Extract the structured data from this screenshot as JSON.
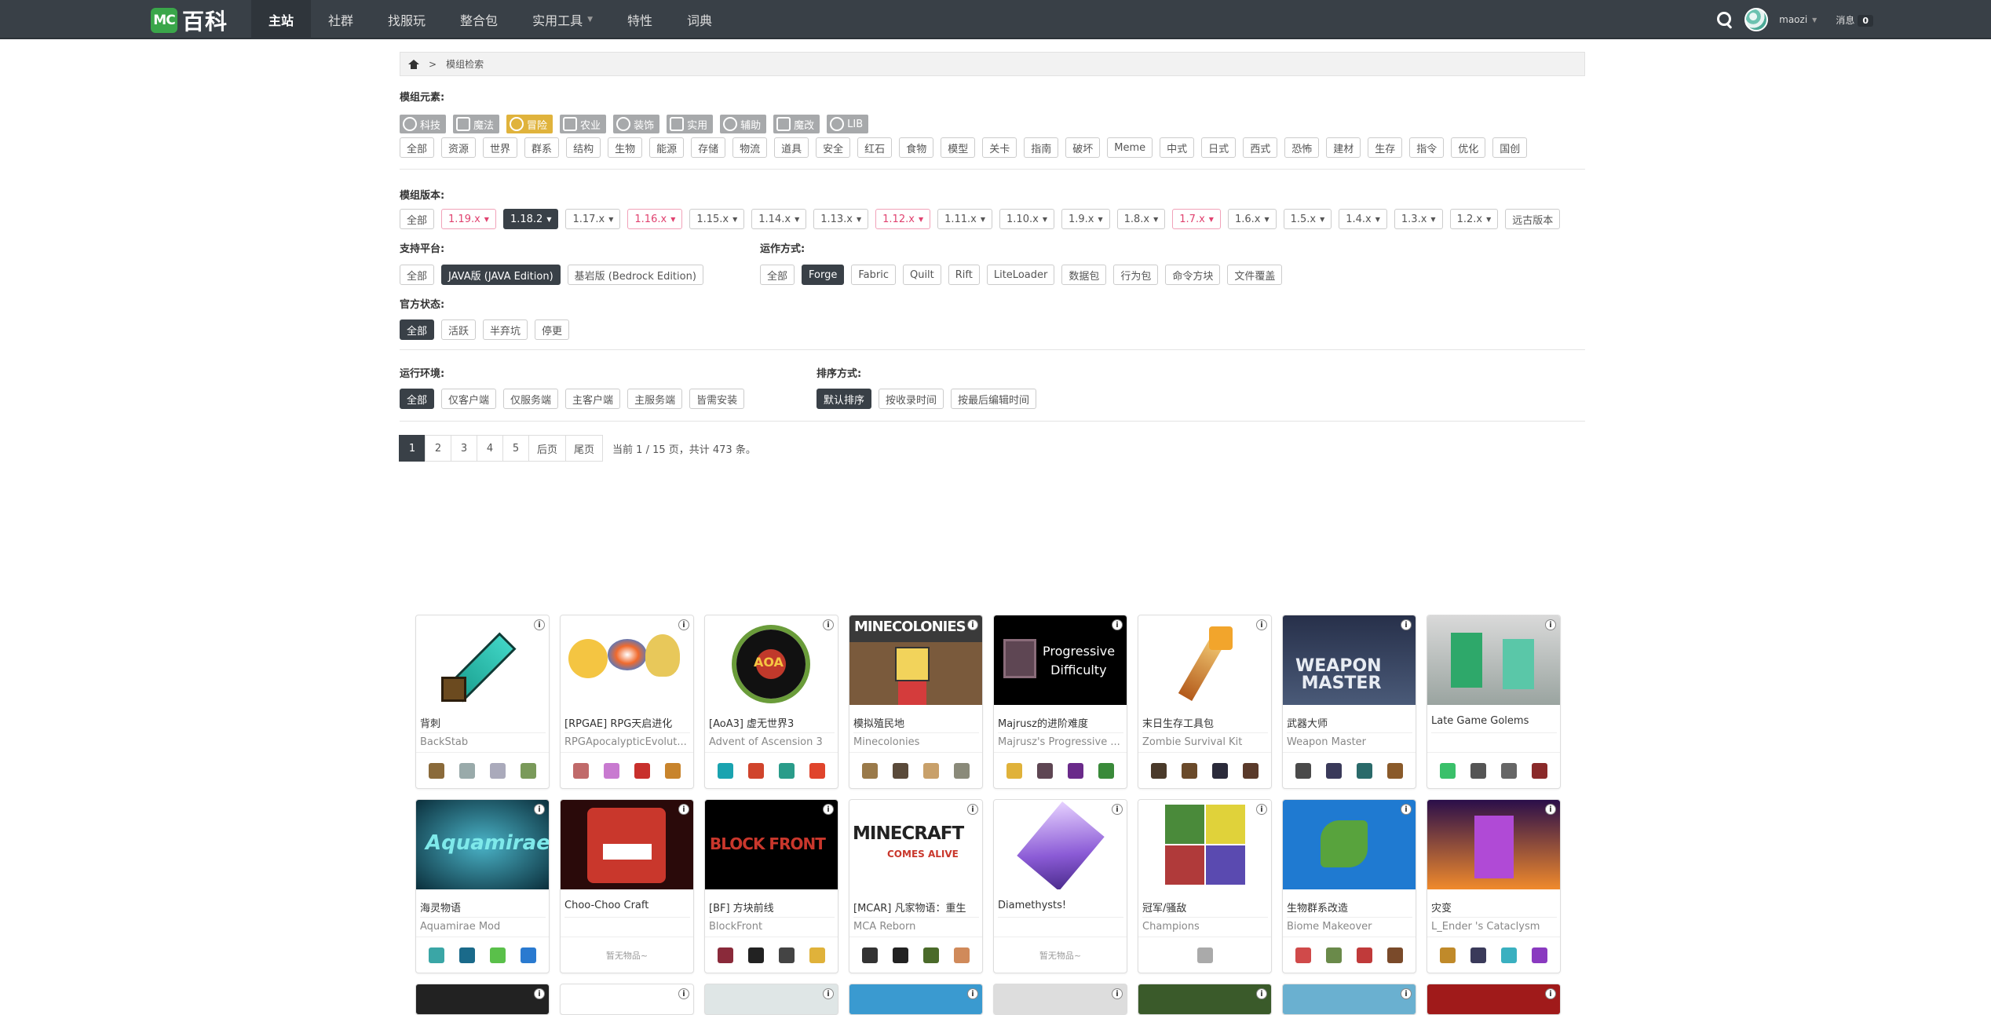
{
  "header": {
    "logo_mc": "MC",
    "logo_text": "百科",
    "nav": [
      {
        "label": "主站",
        "active": true
      },
      {
        "label": "社群"
      },
      {
        "label": "找服玩"
      },
      {
        "label": "整合包"
      },
      {
        "label": "实用工具",
        "dropdown": true
      },
      {
        "label": "特性"
      },
      {
        "label": "词典"
      }
    ],
    "username": "maozi",
    "messages_label": "消息",
    "messages_count": "0"
  },
  "breadcrumb": {
    "current": "模组检索",
    "separator": ">"
  },
  "filters": {
    "elements_label": "模组元素:",
    "elements": [
      "科技",
      "魔法",
      "冒险",
      "农业",
      "装饰",
      "实用",
      "辅助",
      "魔改",
      "LIB"
    ],
    "element_active": "冒险",
    "categories": [
      "全部",
      "资源",
      "世界",
      "群系",
      "结构",
      "生物",
      "能源",
      "存储",
      "物流",
      "道具",
      "安全",
      "红石",
      "食物",
      "模型",
      "关卡",
      "指南",
      "破坏",
      "Meme",
      "中式",
      "日式",
      "西式",
      "恐怖",
      "建材",
      "生存",
      "指令",
      "优化",
      "国创"
    ],
    "version_label": "模组版本:",
    "versions": [
      {
        "label": "全部"
      },
      {
        "label": "1.19.x",
        "pink": true,
        "dd": true
      },
      {
        "label": "1.18.2",
        "dark": true,
        "dd": true
      },
      {
        "label": "1.17.x",
        "dd": true
      },
      {
        "label": "1.16.x",
        "pink": true,
        "dd": true
      },
      {
        "label": "1.15.x",
        "dd": true
      },
      {
        "label": "1.14.x",
        "dd": true
      },
      {
        "label": "1.13.x",
        "dd": true
      },
      {
        "label": "1.12.x",
        "pink": true,
        "dd": true
      },
      {
        "label": "1.11.x",
        "dd": true
      },
      {
        "label": "1.10.x",
        "dd": true
      },
      {
        "label": "1.9.x",
        "dd": true
      },
      {
        "label": "1.8.x",
        "dd": true
      },
      {
        "label": "1.7.x",
        "pink": true,
        "dd": true
      },
      {
        "label": "1.6.x",
        "dd": true
      },
      {
        "label": "1.5.x",
        "dd": true
      },
      {
        "label": "1.4.x",
        "dd": true
      },
      {
        "label": "1.3.x",
        "dd": true
      },
      {
        "label": "1.2.x",
        "dd": true
      },
      {
        "label": "远古版本"
      }
    ],
    "platform_label": "支持平台:",
    "platforms": [
      {
        "label": "全部"
      },
      {
        "label": "JAVA版 (JAVA Edition)",
        "dark": true
      },
      {
        "label": "基岩版 (Bedrock Edition)"
      }
    ],
    "runtime_label": "运作方式:",
    "runtimes": [
      {
        "label": "全部"
      },
      {
        "label": "Forge",
        "dark": true
      },
      {
        "label": "Fabric"
      },
      {
        "label": "Quilt"
      },
      {
        "label": "Rift"
      },
      {
        "label": "LiteLoader"
      },
      {
        "label": "数据包"
      },
      {
        "label": "行为包"
      },
      {
        "label": "命令方块"
      },
      {
        "label": "文件覆盖"
      }
    ],
    "status_label": "官方状态:",
    "statuses": [
      {
        "label": "全部",
        "dark": true
      },
      {
        "label": "活跃"
      },
      {
        "label": "半弃坑"
      },
      {
        "label": "停更"
      }
    ],
    "env_label": "运行环境:",
    "envs": [
      {
        "label": "全部",
        "dark": true
      },
      {
        "label": "仅客户端"
      },
      {
        "label": "仅服务端"
      },
      {
        "label": "主客户端"
      },
      {
        "label": "主服务端"
      },
      {
        "label": "皆需安装"
      }
    ],
    "sort_label": "排序方式:",
    "sorts": [
      {
        "label": "默认排序",
        "dark": true
      },
      {
        "label": "按收录时间"
      },
      {
        "label": "按最后编辑时间"
      }
    ]
  },
  "pagination": {
    "pages": [
      "1",
      "2",
      "3",
      "4",
      "5"
    ],
    "current": "1",
    "next": "后页",
    "last": "尾页",
    "info": "当前 1 / 15 页，共计 473 条。"
  },
  "cards": [
    {
      "title": "背刺",
      "subtitle": "BackStab",
      "art": "sword",
      "items": [
        "#8a6a3a",
        "#9aa",
        "#aab",
        "#7a9a5a"
      ]
    },
    {
      "title": "[RPGAE] RPG天启进化",
      "subtitle": "RPGApocalypticEvolut...",
      "art": "rpg",
      "items": [
        "#c06a6a",
        "#c87ad0",
        "#c8302c",
        "#c8842c"
      ]
    },
    {
      "title": "[AoA3] 虚无世界3",
      "subtitle": "Advent of Ascension 3",
      "art": "aoa",
      "items": [
        "#1aa3b0",
        "#d0442c",
        "#2a9c8a",
        "#e0442c"
      ]
    },
    {
      "title": "模拟殖民地",
      "subtitle": "Minecolonies",
      "art": "colony",
      "items": [
        "#9a7a4a",
        "#5a4a3a",
        "#c8a06a",
        "#8a8a7a"
      ]
    },
    {
      "title": "Majrusz的进阶难度",
      "subtitle": "Majrusz's Progressive ...",
      "art": "prog",
      "items": [
        "#e0b23a",
        "#5e4653",
        "#6a2a8a",
        "#3a8a3a"
      ]
    },
    {
      "title": "末日生存工具包",
      "subtitle": "Zombie Survival Kit",
      "art": "zomb",
      "items": [
        "#4a3a2a",
        "#6a4a2a",
        "#2a2a3a",
        "#5a3a2a"
      ]
    },
    {
      "title": "武器大师",
      "subtitle": "Weapon Master",
      "art": "weapon",
      "items": [
        "#4a4a4a",
        "#3a3a5a",
        "#2a6a6a",
        "#8a5a2a"
      ]
    },
    {
      "title": "Late Game Golems",
      "subtitle": "",
      "art": "golem",
      "items": [
        "#3ac06a",
        "#555",
        "#666",
        "#8a2a2a"
      ]
    },
    {
      "title": "海灵物语",
      "subtitle": "Aquamirae Mod",
      "art": "aqua",
      "items": [
        "#3aa6a6",
        "#1a6a8a",
        "#5ac04a",
        "#2a7ad0"
      ]
    },
    {
      "title": "Choo-Choo Craft",
      "subtitle": "",
      "art": "choo",
      "items": [],
      "no_items": "暂无物品~"
    },
    {
      "title": "[BF] 方块前线",
      "subtitle": "BlockFront",
      "art": "block",
      "items": [
        "#8a2a3a",
        "#222",
        "#444",
        "#e0b23a"
      ]
    },
    {
      "title": "[MCAR] 凡家物语：重生",
      "subtitle": "MCA Reborn",
      "art": "mca",
      "items": [
        "#333",
        "#222",
        "#4a6a2a",
        "#d08a5a"
      ]
    },
    {
      "title": "Diamethysts!",
      "subtitle": "",
      "art": "dia",
      "items": [],
      "no_items": "暂无物品~"
    },
    {
      "title": "冠军/骚敌",
      "subtitle": "Champions",
      "art": "champ",
      "items": [
        "#aaa"
      ]
    },
    {
      "title": "生物群系改造",
      "subtitle": "Biome Makeover",
      "art": "biome",
      "items": [
        "#d04a4a",
        "#6a8a4a",
        "#c03a3a",
        "#7a4a2a"
      ]
    },
    {
      "title": "灾变",
      "subtitle": "L_Ender 's Cataclysm",
      "art": "ender",
      "items": [
        "#c08a2a",
        "#3a3a5a",
        "#3ab0c0",
        "#8a3ac0"
      ]
    }
  ],
  "card_info_glyph": "i"
}
